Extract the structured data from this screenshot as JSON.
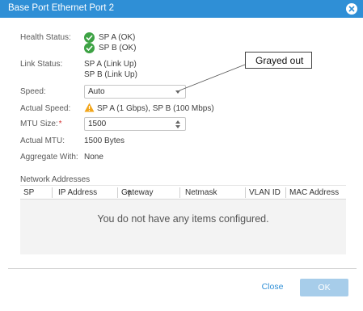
{
  "dialog": {
    "title": "Base Port Ethernet Port 2"
  },
  "fields": {
    "health_status": {
      "label": "Health Status:",
      "values": [
        "SP A (OK)",
        "SP B (OK)"
      ]
    },
    "link_status": {
      "label": "Link Status:",
      "values": [
        "SP A (Link Up)",
        "SP B (Link Up)"
      ]
    },
    "speed": {
      "label": "Speed:",
      "value": "Auto"
    },
    "actual_speed": {
      "label": "Actual Speed:",
      "value": "SP A (1 Gbps), SP B (100 Mbps)"
    },
    "mtu_size": {
      "label": "MTU Size:",
      "required_mark": "*",
      "value": "1500"
    },
    "actual_mtu": {
      "label": "Actual MTU:",
      "value": "1500 Bytes"
    },
    "aggregate_with": {
      "label": "Aggregate With:",
      "value": "None"
    }
  },
  "callout": {
    "text": "Grayed out"
  },
  "network_addresses": {
    "title": "Network Addresses",
    "columns": [
      "SP",
      "IP Address",
      "Gateway",
      "Netmask",
      "VLAN ID",
      "MAC Address"
    ],
    "empty_message": "You do not have any items configured."
  },
  "buttons": {
    "close": "Close",
    "ok": "OK"
  },
  "colors": {
    "accent": "#2f8fd6",
    "ok_green": "#3da244",
    "warning": "#f2a51a",
    "required": "#d32f2f",
    "ok_disabled": "#a7cdea"
  },
  "icons": {
    "titlebar": "close-icon",
    "health": "check-circle-icon",
    "actual_speed": "warning-icon",
    "sort": "sort-ascending-icon"
  }
}
